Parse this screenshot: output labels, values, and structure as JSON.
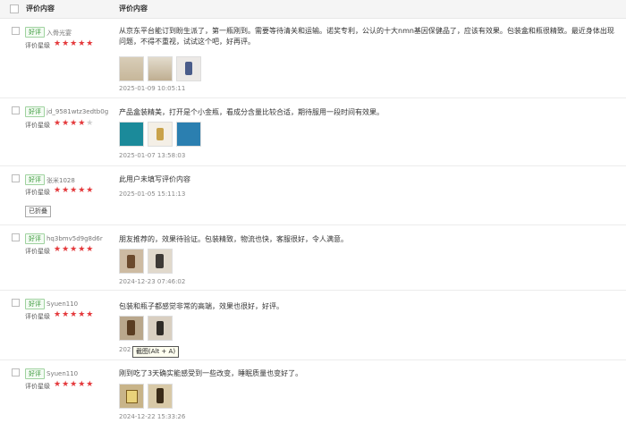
{
  "header": {
    "col_review_content": "评价内容",
    "col_review_detail": "评价内容"
  },
  "reviews": [
    {
      "badge": "好评",
      "user": "入骨光宴",
      "rating_label": "评价星级",
      "stars": 5,
      "text": "从京东平台能订到盼生派了，第一瓶刚到。需要等待清关和运输。诺奖专利，公认的十大nmn基因保健品了，应该有效果。包装盒和瓶很精致。最近身体出现问题，不得不重视，试试这个吧，好再评。",
      "date": "2025-01-09 10:05:11",
      "images": 3
    },
    {
      "badge": "好评",
      "user": "jd_9581wtz3edtb0g",
      "rating_label": "评价星级",
      "stars": 4,
      "text": "产品盒装精美，打开是个小金瓶，看成分含量比较合适，期待服用一段时间有效果。",
      "date": "2025-01-07 13:58:03",
      "images": 3
    },
    {
      "badge": "好评",
      "user": "张米1028",
      "rating_label": "评价星级",
      "stars": 5,
      "text": "此用户未填写评价内容",
      "date": "2025-01-05 15:11:13",
      "folded": "已折叠",
      "images": 0
    },
    {
      "badge": "好评",
      "user": "hq3bmv5d9g8d6r",
      "rating_label": "评价星级",
      "stars": 5,
      "text": "朋友推荐的，效果待验证。包装精致，物流也快，客服很好，令人满意。",
      "date": "2024-12-23 07:46:02",
      "images": 2
    },
    {
      "badge": "好评",
      "user": "Syuen110",
      "rating_label": "评价星级",
      "stars": 5,
      "text": "包装和瓶子都感觉非常的高端，效果也很好，好评。",
      "date_prefix": "202",
      "date_suffix": "36",
      "images": 2
    },
    {
      "badge": "好评",
      "user": "Syuen110",
      "rating_label": "评价星级",
      "stars": 5,
      "text": "刚到吃了3天确实能感受到一些改变，睡眠质量也变好了。",
      "date": "2024-12-22 15:33:26",
      "images": 2
    }
  ],
  "tooltip": "截图(Alt + A)",
  "colors": {
    "star": "#e4393c",
    "badge_border": "#9fd29f",
    "badge_text": "#3b9a3b"
  }
}
